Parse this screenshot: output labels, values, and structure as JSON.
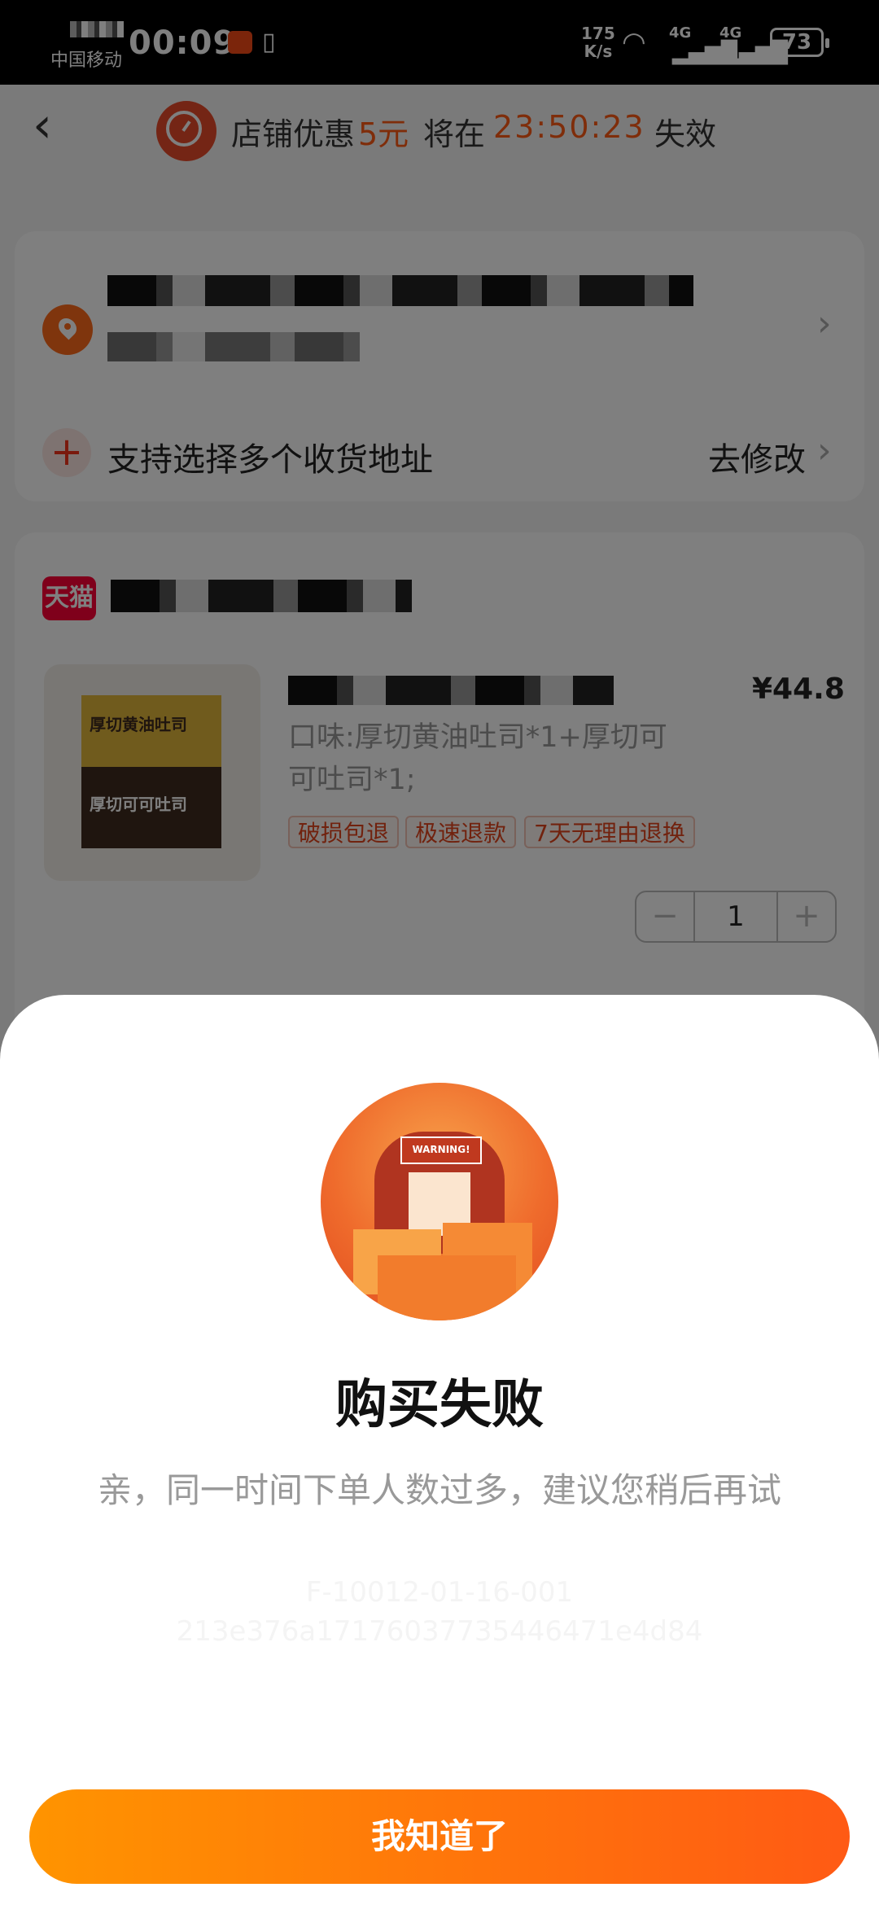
{
  "status_bar": {
    "carrier": "中国移动",
    "time": "00:09",
    "speed_value": "175",
    "speed_unit": "K/s",
    "network_1": "4G",
    "network_2": "4G",
    "battery": "73"
  },
  "header": {
    "prefix": "店铺优惠",
    "amount": "5元",
    "middle": "将在",
    "countdown": "23:50:23",
    "suffix": "失效"
  },
  "address": {
    "multi_label": "支持选择多个收货地址",
    "edit_label": "去修改"
  },
  "order": {
    "store_badge": "天猫",
    "price": "¥44.8",
    "spec": "口味:厚切黄油吐司*1+厚切可可吐司*1;",
    "product_image_text_top": "厚切黄油吐司",
    "product_image_text_bottom": "厚切可可吐司",
    "tags": [
      "破损包退",
      "极速退款",
      "7天无理由退换"
    ],
    "quantity": "1",
    "minus": "−",
    "plus": "+"
  },
  "dialog": {
    "illustration_text": "WARNING!",
    "title": "购买失败",
    "message": "亲，同一时间下单人数过多，建议您稍后再试",
    "error_code_line1": "F-10012-01-16-001",
    "error_code_line2": "213e376a17176037735446471e4d84",
    "confirm_label": "我知道了"
  }
}
